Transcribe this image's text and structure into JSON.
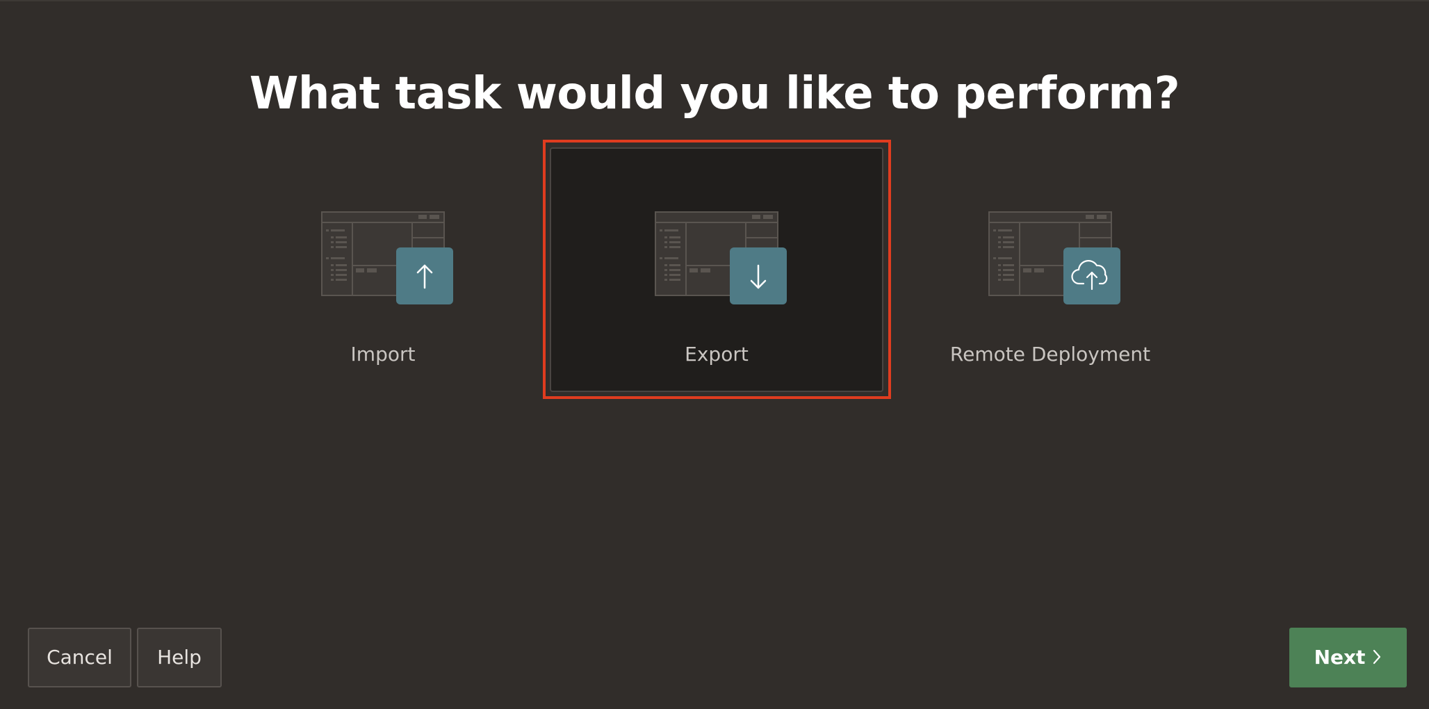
{
  "heading": "What task would you like to perform?",
  "options": [
    {
      "label": "Import",
      "icon": "upload-arrow-icon",
      "selected": false
    },
    {
      "label": "Export",
      "icon": "download-arrow-icon",
      "selected": true
    },
    {
      "label": "Remote Deployment",
      "icon": "cloud-upload-icon",
      "selected": false
    }
  ],
  "footer": {
    "cancel_label": "Cancel",
    "help_label": "Help",
    "next_label": "Next"
  },
  "colors": {
    "background": "#312d2a",
    "selected_card": "#201e1c",
    "highlight": "#e03c1f",
    "icon_badge": "#4f7b86",
    "next_button": "#4d8256"
  }
}
